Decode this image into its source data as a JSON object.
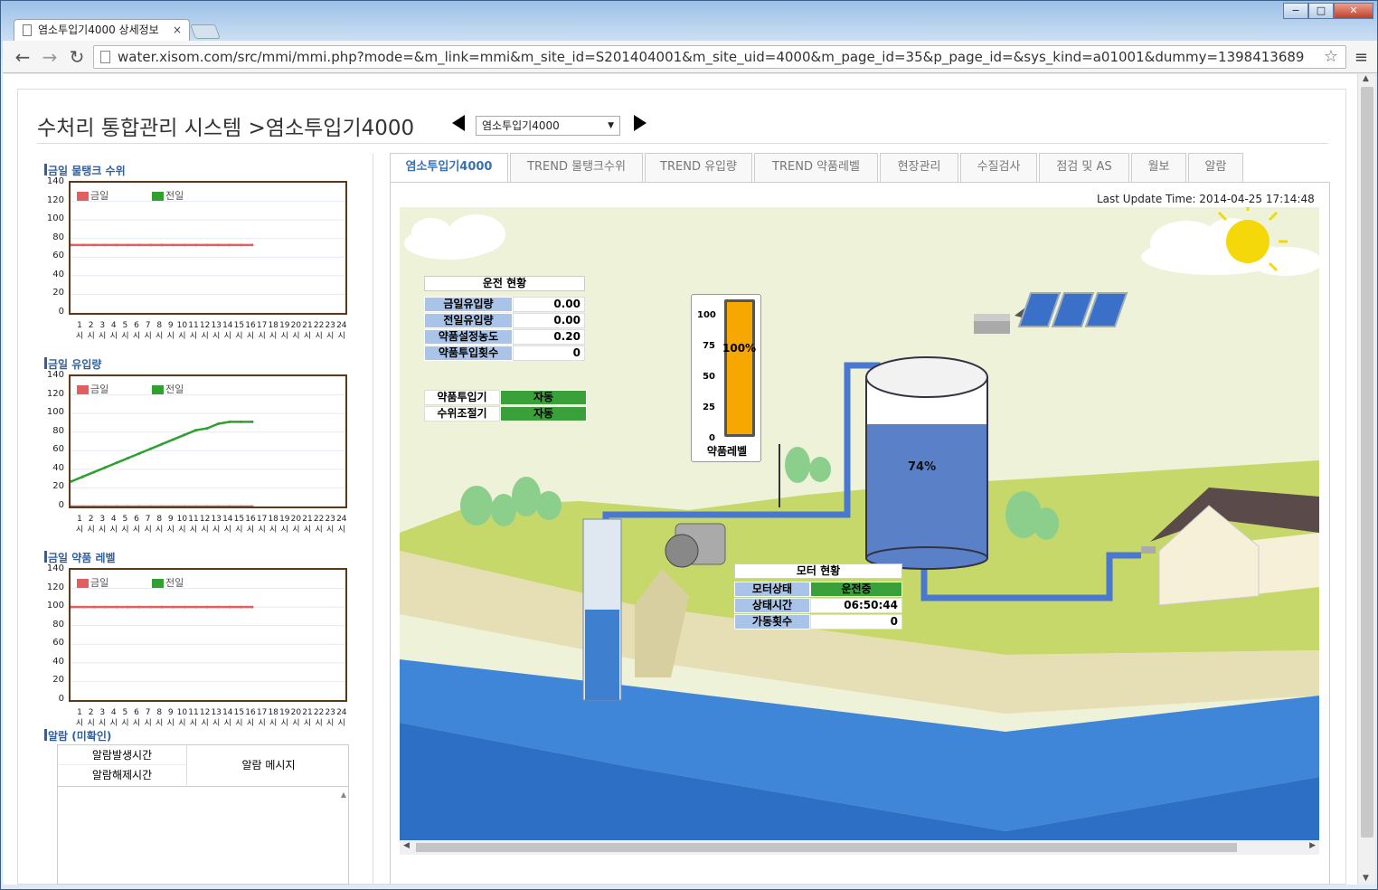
{
  "browser": {
    "tab_title": "염소투입기4000 상세정보",
    "url": "water.xisom.com/src/mmi/mmi.php?mode=&m_link=mmi&m_site_id=S201404001&m_site_uid=4000&m_page_id=35&p_page_id=&sys_kind=a01001&dummy=1398413689",
    "win_min": "−",
    "win_max": "□",
    "win_close": "✕",
    "tab_close": "×",
    "back": "←",
    "forward": "→",
    "reload": "↻",
    "star": "☆",
    "menu": "≡"
  },
  "header": {
    "title": "수처리 통합관리 시스템 >염소투입기4000",
    "select_value": "염소투입기4000",
    "select_arrow": "▼"
  },
  "left": {
    "chart1_title": "금일 물탱크 수위",
    "chart2_title": "금일 유입량",
    "chart3_title": "금일 약품 레벨",
    "legend_today": "금일",
    "legend_yesterday": "전일",
    "alarm_title": "알람 (미확인)",
    "alarm_col1a": "알람발생시간",
    "alarm_col1b": "알람해제시간",
    "alarm_col2": "알람 메시지",
    "scroll_up": "▲"
  },
  "chart_data": [
    {
      "type": "line",
      "title": "금일 물탱크 수위",
      "x": [
        "1시",
        "2시",
        "3시",
        "4시",
        "5시",
        "6시",
        "7시",
        "8시",
        "9시",
        "10시",
        "11시",
        "12시",
        "13시",
        "14시",
        "15시",
        "16시",
        "17시",
        "18시",
        "19시",
        "20시",
        "21시",
        "22시",
        "23시",
        "24시"
      ],
      "ylim": [
        0,
        140
      ],
      "yticks": [
        0,
        20,
        40,
        60,
        80,
        100,
        120,
        140
      ],
      "series": [
        {
          "name": "금일",
          "color": "#e06060",
          "values": [
            73,
            73,
            73,
            73,
            73,
            73,
            73,
            73,
            73,
            73,
            73,
            73,
            73,
            73,
            73,
            73,
            73
          ]
        },
        {
          "name": "전일",
          "color": "#30a030",
          "values": []
        }
      ]
    },
    {
      "type": "line",
      "title": "금일 유입량",
      "x": [
        "1시",
        "2시",
        "3시",
        "4시",
        "5시",
        "6시",
        "7시",
        "8시",
        "9시",
        "10시",
        "11시",
        "12시",
        "13시",
        "14시",
        "15시",
        "16시",
        "17시",
        "18시",
        "19시",
        "20시",
        "21시",
        "22시",
        "23시",
        "24시"
      ],
      "ylim": [
        0,
        140
      ],
      "yticks": [
        0,
        20,
        40,
        60,
        80,
        100,
        120,
        140
      ],
      "series": [
        {
          "name": "전일",
          "color": "#30a030",
          "values": [
            27,
            32,
            37,
            42,
            47,
            52,
            57,
            62,
            67,
            72,
            77,
            82,
            84,
            89,
            91,
            91,
            91
          ]
        },
        {
          "name": "금일",
          "color": "#e06060",
          "values": [
            0,
            0,
            0,
            0,
            0,
            0,
            0,
            0,
            0,
            0,
            0,
            0,
            0,
            0,
            0,
            0,
            0
          ]
        }
      ]
    },
    {
      "type": "line",
      "title": "금일 약품 레벨",
      "x": [
        "1시",
        "2시",
        "3시",
        "4시",
        "5시",
        "6시",
        "7시",
        "8시",
        "9시",
        "10시",
        "11시",
        "12시",
        "13시",
        "14시",
        "15시",
        "16시",
        "17시",
        "18시",
        "19시",
        "20시",
        "21시",
        "22시",
        "23시",
        "24시"
      ],
      "ylim": [
        0,
        140
      ],
      "yticks": [
        0,
        20,
        40,
        60,
        80,
        100,
        120,
        140
      ],
      "series": [
        {
          "name": "금일",
          "color": "#e06060",
          "values": [
            100,
            100,
            100,
            100,
            100,
            100,
            100,
            100,
            100,
            100,
            100,
            100,
            100,
            100,
            100,
            100,
            100
          ]
        },
        {
          "name": "전일",
          "color": "#30a030",
          "values": []
        }
      ]
    }
  ],
  "tabs": [
    "염소투입기4000",
    "TREND 물탱크수위",
    "TREND 유입량",
    "TREND 약품레벨",
    "현장관리",
    "수질검사",
    "점검 및 AS",
    "월보",
    "알람"
  ],
  "last_update": "Last Update Time: 2014-04-25 17:14:48",
  "operation": {
    "title": "운전 현황",
    "rows": [
      {
        "label": "금일유입량",
        "value": "0.00"
      },
      {
        "label": "전일유입량",
        "value": "0.00"
      },
      {
        "label": "약품설정농도",
        "value": "0.20"
      },
      {
        "label": "약품투입횟수",
        "value": "0"
      }
    ]
  },
  "modes": [
    {
      "label": "약품투입기",
      "value": "자동"
    },
    {
      "label": "수위조절기",
      "value": "자동"
    }
  ],
  "chem_gauge": {
    "ticks": [
      "100",
      "75",
      "50",
      "25",
      "0"
    ],
    "percent_text": "100%",
    "level": 1.0,
    "label": "약품레벨"
  },
  "tank": {
    "percent_text": "74%",
    "level": 0.74
  },
  "motor": {
    "title": "모터 현황",
    "rows": [
      {
        "label": "모터상태",
        "value": "운전중"
      },
      {
        "label": "상태시간",
        "value": "06:50:44"
      },
      {
        "label": "가동횟수",
        "value": "0"
      }
    ]
  },
  "scroll": {
    "left": "◀",
    "right": "▶",
    "up": "▲",
    "down": "▼"
  }
}
